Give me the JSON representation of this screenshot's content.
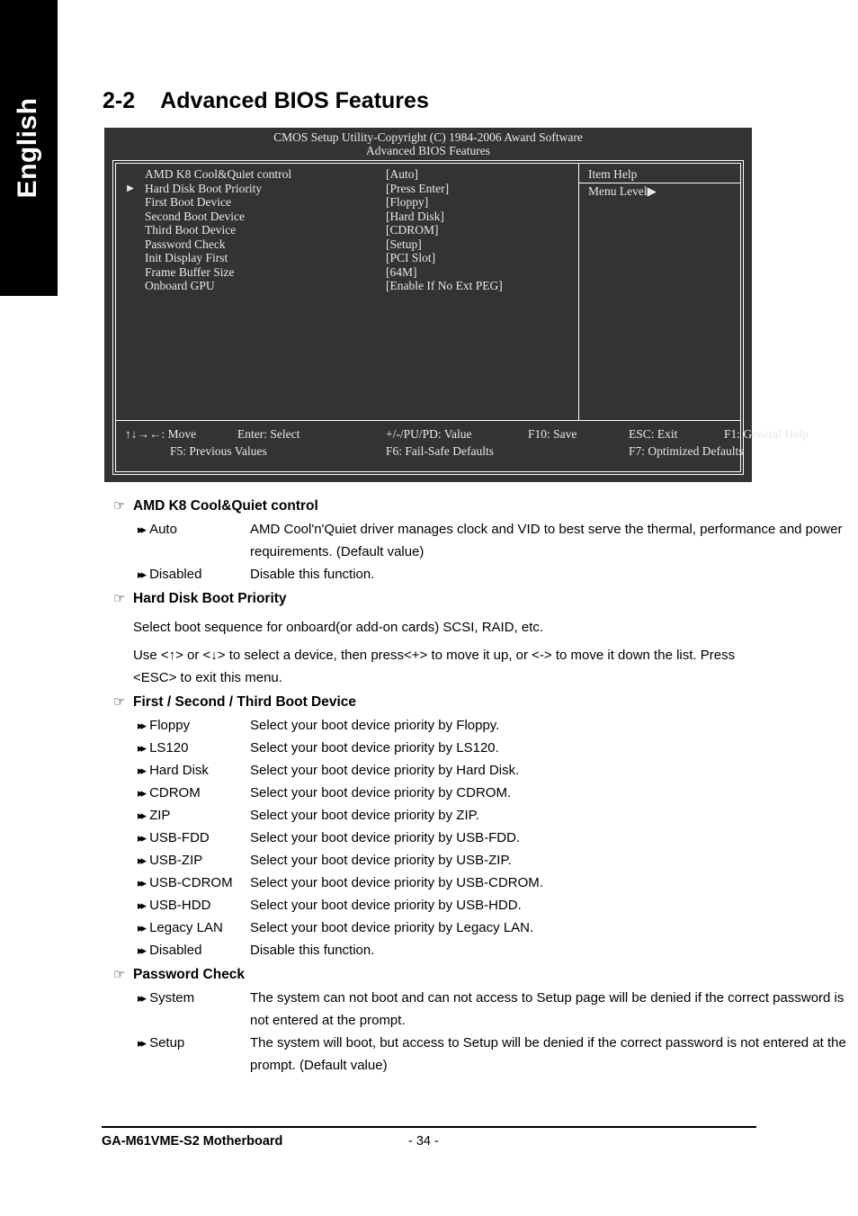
{
  "language_tab": {
    "label": "English"
  },
  "page_title": {
    "number": "2-2",
    "text": "Advanced BIOS Features"
  },
  "bios_screen": {
    "header_line1": "CMOS Setup Utility-Copyright (C) 1984-2006 Award Software",
    "header_line2": "Advanced BIOS Features",
    "items": [
      {
        "arrow": "",
        "label": "AMD K8 Cool&Quiet control",
        "value": "[Auto]"
      },
      {
        "arrow": "▶",
        "label": "Hard Disk Boot Priority",
        "value": "[Press Enter]"
      },
      {
        "arrow": "",
        "label": "First Boot Device",
        "value": "[Floppy]"
      },
      {
        "arrow": "",
        "label": "Second Boot Device",
        "value": "[Hard Disk]"
      },
      {
        "arrow": "",
        "label": "Third Boot Device",
        "value": "[CDROM]"
      },
      {
        "arrow": "",
        "label": "Password Check",
        "value": "[Setup]"
      },
      {
        "arrow": "",
        "label": "Init Display First",
        "value": "[PCI Slot]"
      },
      {
        "arrow": "",
        "label": "Frame Buffer Size",
        "value": "[64M]"
      },
      {
        "arrow": "",
        "label": "Onboard GPU",
        "value": "[Enable If No Ext PEG]"
      }
    ],
    "help": {
      "title": "Item Help",
      "body": "Menu Level▶"
    },
    "keys_row1": [
      "↑↓→←: Move",
      "Enter: Select",
      "+/-/PU/PD: Value",
      "F10: Save",
      "ESC: Exit",
      "F1: General Help"
    ],
    "keys_row2": [
      "F5: Previous Values",
      "F6: Fail-Safe Defaults",
      "F7: Optimized Defaults"
    ]
  },
  "sections": [
    {
      "title": "AMD K8 Cool&Quiet control",
      "options": [
        {
          "name": "Auto",
          "desc": "AMD Cool'n'Quiet driver manages clock and VID to best serve the thermal, performance and power requirements. (Default value)"
        },
        {
          "name": "Disabled",
          "desc": "Disable this function."
        }
      ],
      "paragraphs": []
    },
    {
      "title": "Hard Disk Boot Priority",
      "options": [],
      "paragraphs": [
        "Select boot sequence for onboard(or add-on cards) SCSI, RAID, etc.",
        "Use <↑> or <↓> to select a device, then press<+> to move it up, or <-> to move it down the list. Press <ESC> to exit this menu."
      ]
    },
    {
      "title": "First / Second / Third Boot Device",
      "options": [
        {
          "name": "Floppy",
          "desc": "Select your boot device priority by Floppy."
        },
        {
          "name": "LS120",
          "desc": "Select your boot device priority by LS120."
        },
        {
          "name": "Hard Disk",
          "desc": "Select your boot device priority by Hard Disk."
        },
        {
          "name": "CDROM",
          "desc": "Select your boot device priority by CDROM."
        },
        {
          "name": "ZIP",
          "desc": "Select your boot device priority by ZIP."
        },
        {
          "name": "USB-FDD",
          "desc": "Select your boot device priority by USB-FDD."
        },
        {
          "name": "USB-ZIP",
          "desc": "Select your boot device priority by USB-ZIP."
        },
        {
          "name": "USB-CDROM",
          "desc": "Select your boot device priority by USB-CDROM."
        },
        {
          "name": "USB-HDD",
          "desc": "Select your boot device priority by USB-HDD."
        },
        {
          "name": "Legacy LAN",
          "desc": "Select your boot device priority by Legacy LAN."
        },
        {
          "name": "Disabled",
          "desc": "Disable this function."
        }
      ],
      "paragraphs": []
    },
    {
      "title": "Password Check",
      "options": [
        {
          "name": "System",
          "desc": "The system can not boot and can not access to Setup page will be denied if the correct password is not entered at the prompt."
        },
        {
          "name": "Setup",
          "desc": "The system will boot, but access to Setup will be denied if the correct password is not entered at the prompt. (Default value)"
        }
      ],
      "paragraphs": []
    }
  ],
  "footer": {
    "left": "GA-M61VME-S2 Motherboard",
    "page": "- 34 -"
  },
  "icons": {
    "hand": "☞",
    "double_arrow": "▸▸"
  },
  "colors": {
    "bios_background": "#333333",
    "bios_text": "#E8E8E8",
    "tab_background": "#000000",
    "page_background": "#FFFFFF"
  }
}
